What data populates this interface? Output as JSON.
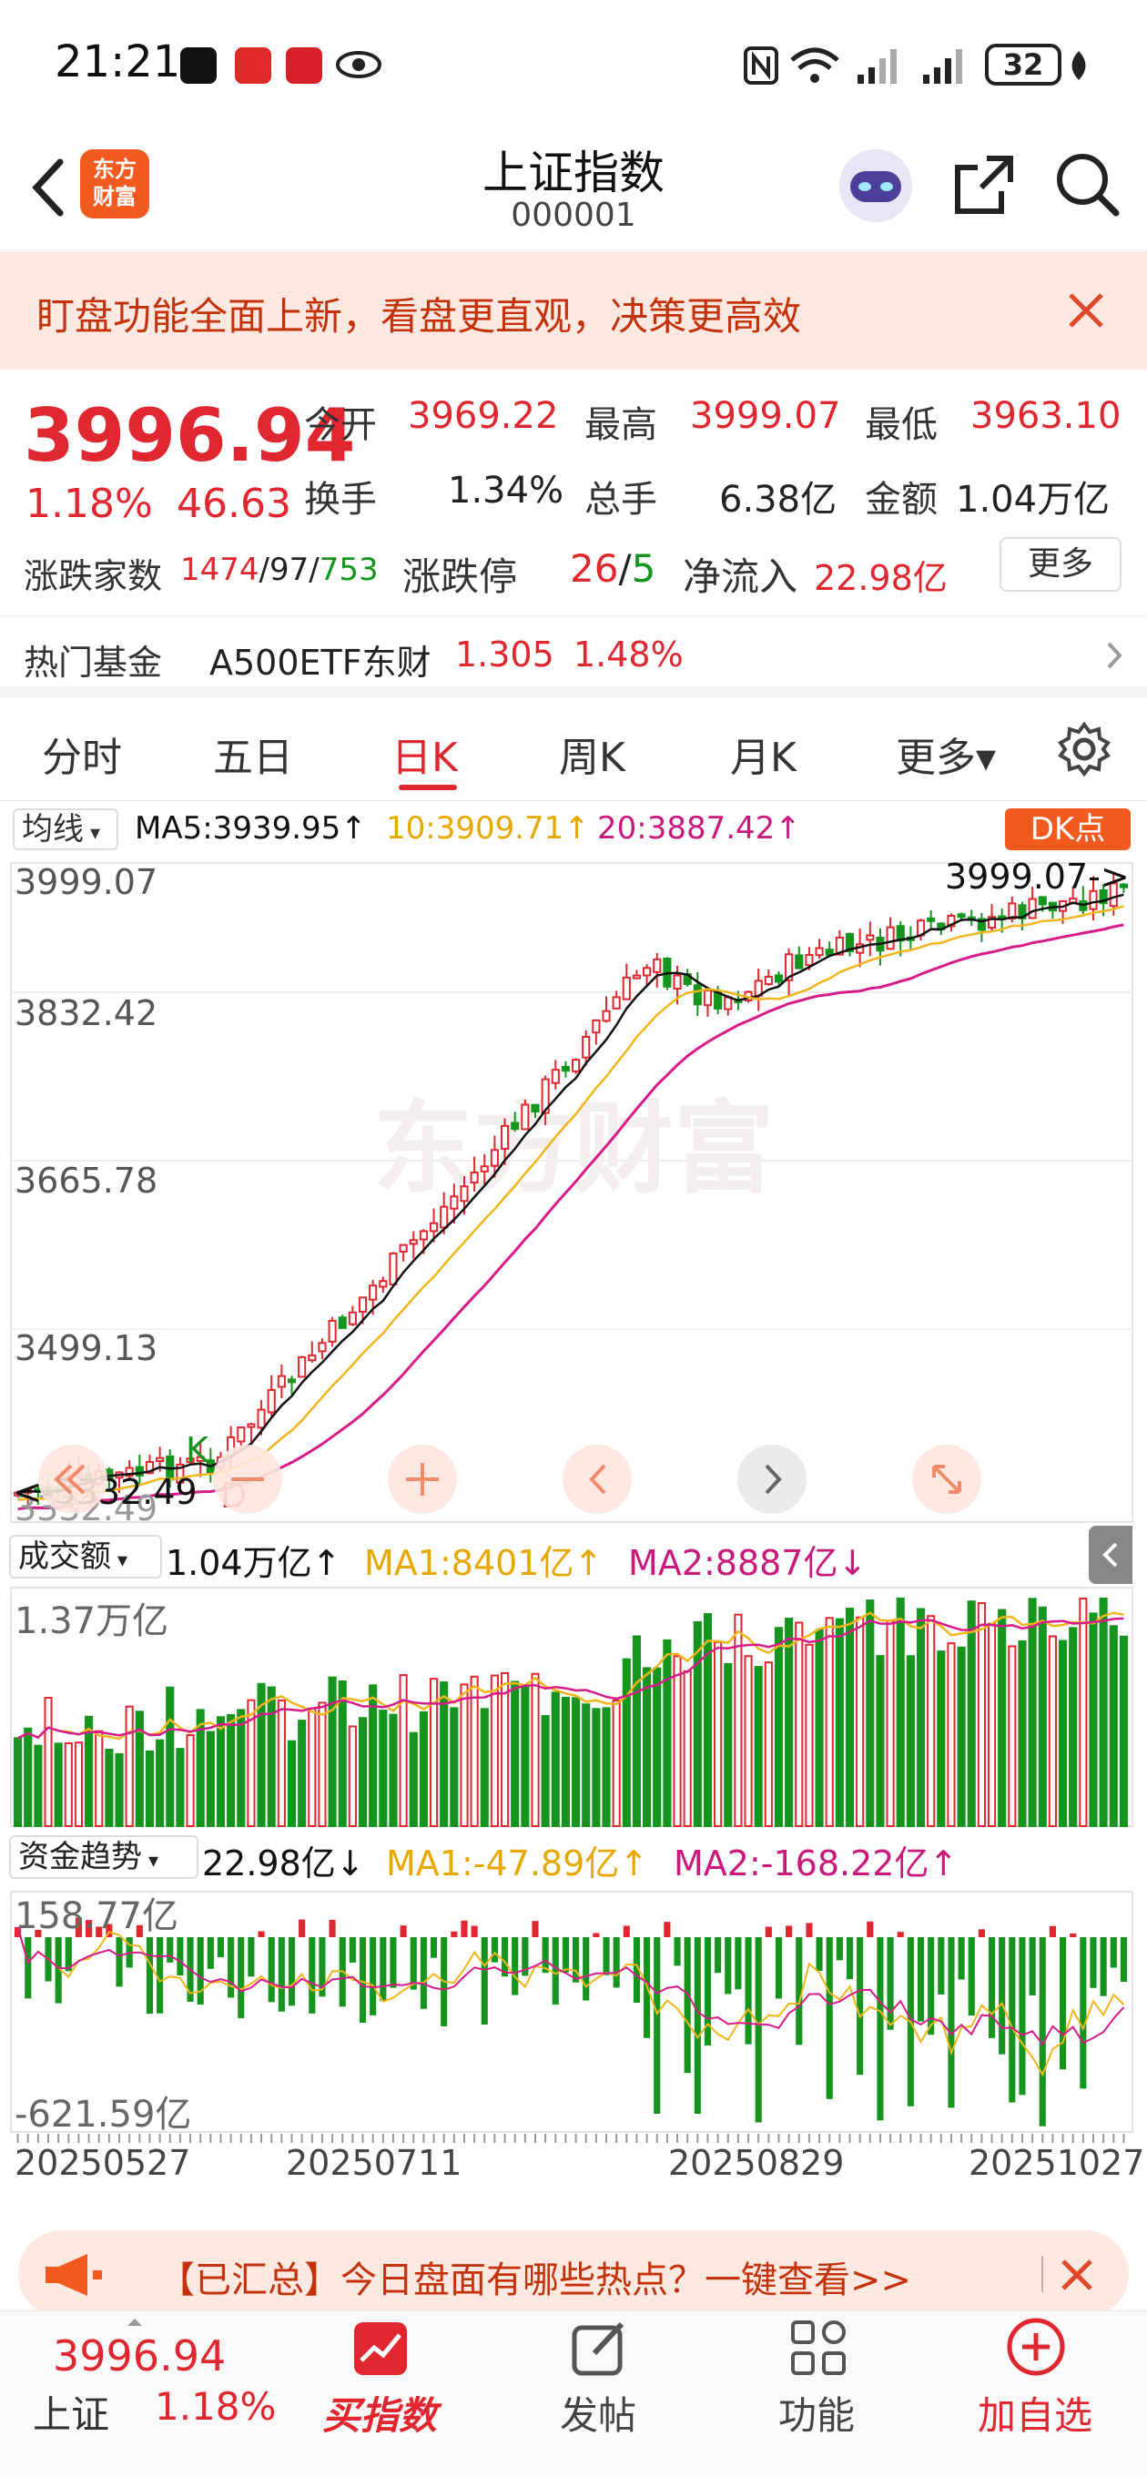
{
  "status_bar": {
    "time": "21:21",
    "battery": "32",
    "icons": [
      "tiktok-icon",
      "huawei-app-icon",
      "securities-app-icon",
      "eye-icon",
      "nfc-icon",
      "wifi-icon",
      "signal-icon",
      "signal-icon",
      "battery-icon",
      "leaf-icon"
    ]
  },
  "header": {
    "logo_line1": "东方",
    "logo_line2": "财富",
    "title": "上证指数",
    "code": "000001"
  },
  "notice": {
    "text": "盯盘功能全面上新，看盘更直观，决策更高效"
  },
  "quote": {
    "price": "3996.94",
    "change_pct": "1.18%",
    "change_pts": "46.63",
    "open_label": "今开",
    "open": "3969.22",
    "high_label": "最高",
    "high": "3999.07",
    "low_label": "最低",
    "low": "3963.10",
    "turnover_label": "换手",
    "turnover": "1.34%",
    "volume_label": "总手",
    "volume": "6.38亿",
    "amount_label": "金额",
    "amount": "1.04万亿",
    "breadth_label": "涨跌家数",
    "breadth_up": "1474",
    "breadth_flat": "97",
    "breadth_down": "753",
    "sep": "/",
    "limit_label": "涨跌停",
    "limit_up": "26",
    "limit_down": "5",
    "inflow_label": "净流入",
    "inflow": "22.98亿",
    "more_button": "更多"
  },
  "hot_fund": {
    "label": "热门基金",
    "name": "A500ETF东财",
    "price": "1.305",
    "pct": "1.48%"
  },
  "tabs": [
    "分时",
    "五日",
    "日K",
    "周K",
    "月K",
    "更多▾"
  ],
  "kline": {
    "indicator_select": "均线",
    "ma5": "MA5:3939.95↑",
    "ma10": "10:3909.71↑",
    "ma20": "20:3887.42↑",
    "dk_button": "DK点",
    "y_labels": [
      "3999.07",
      "3832.42",
      "3665.78",
      "3499.13",
      "3332.49"
    ],
    "max_marker": "3999.07->",
    "min_marker": "<-3332.49",
    "k_marker": "K",
    "d_marker": "D",
    "watermark": "东方财富",
    "colors": {
      "up": "#e0262f",
      "down": "#15951e",
      "ma5": "#111111",
      "ma10": "#f2b61c",
      "ma20": "#d81b8a"
    }
  },
  "volume_panel": {
    "select": "成交额",
    "value": "1.04万亿↑",
    "ma1": "MA1:8401亿↑",
    "ma2": "MA2:8887亿↓",
    "top_label": "1.37万亿"
  },
  "fund_panel": {
    "select": "资金趋势",
    "value": "22.98亿↓",
    "ma1": "MA1:-47.89亿↑",
    "ma2": "MA2:-168.22亿↑",
    "top_label": "158.77亿",
    "bottom_label": "-621.59亿"
  },
  "dates": [
    "20250527",
    "20250711",
    "20250829",
    "20251027"
  ],
  "message_bar": {
    "text": "【已汇总】今日盘面有哪些热点？一键查看>>"
  },
  "bottom_nav": {
    "mini_price": "3996.94",
    "mini_name": "上证",
    "mini_pct": "1.18%",
    "items": [
      "买指数",
      "发帖",
      "功能",
      "加自选"
    ]
  }
}
